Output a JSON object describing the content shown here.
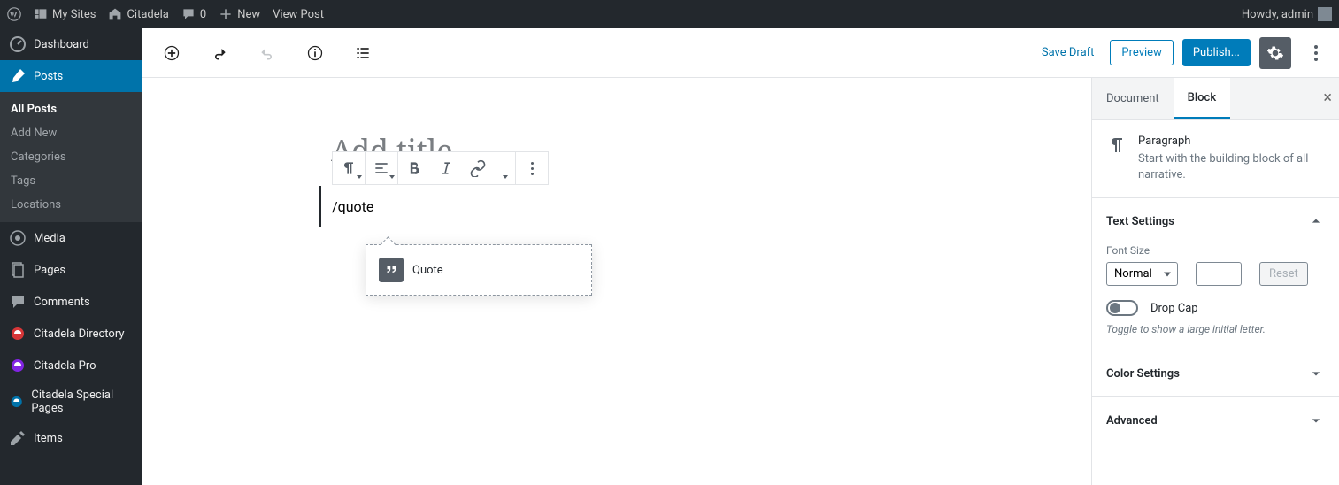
{
  "adminbar": {
    "my_sites": "My Sites",
    "site_name": "Citadela",
    "comments_count": "0",
    "new_label": "New",
    "view_post": "View Post",
    "howdy": "Howdy, admin"
  },
  "sidebar": {
    "dashboard": "Dashboard",
    "posts": "Posts",
    "posts_sub": {
      "all_posts": "All Posts",
      "add_new": "Add New",
      "categories": "Categories",
      "tags": "Tags",
      "locations": "Locations"
    },
    "media": "Media",
    "pages": "Pages",
    "comments": "Comments",
    "citadela_directory": "Citadela Directory",
    "citadela_pro": "Citadela Pro",
    "citadela_special": "Citadela Special Pages",
    "items": "Items"
  },
  "topbar": {
    "save_draft": "Save Draft",
    "preview": "Preview",
    "publish": "Publish..."
  },
  "editor": {
    "title_placeholder": "Add title",
    "block_text": "/quote",
    "autocomplete_item": "Quote"
  },
  "settings": {
    "tabs": {
      "document": "Document",
      "block": "Block"
    },
    "block_title": "Paragraph",
    "block_desc": "Start with the building block of all narrative.",
    "text_settings": "Text Settings",
    "font_size_label": "Font Size",
    "font_size_value": "Normal",
    "reset": "Reset",
    "drop_cap": "Drop Cap",
    "drop_cap_hint": "Toggle to show a large initial letter.",
    "color_settings": "Color Settings",
    "advanced": "Advanced"
  }
}
